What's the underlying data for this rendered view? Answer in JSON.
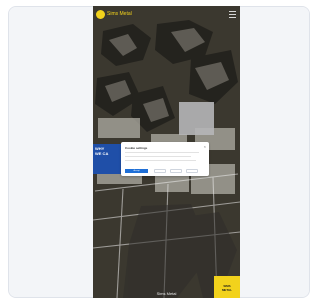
{
  "app": {
    "brand_name": "Sims Metal",
    "footer_brand": "Sims Metal"
  },
  "hero": {
    "badge_line1": "WHY",
    "badge_line2": "WE CA"
  },
  "cookie_dialog": {
    "title": "Cookie settings",
    "close_symbol": "×",
    "accept_label": "Accept"
  },
  "corner_tag": {
    "line1": "SIMS",
    "line2": "METAL"
  },
  "colors": {
    "brand_yellow": "#f2d21c",
    "brand_blue": "#1f4fa8",
    "button_blue": "#1f6fd6"
  },
  "icons": {
    "logo": "sims-logo-icon",
    "menu": "hamburger-menu-icon",
    "close": "close-icon"
  }
}
